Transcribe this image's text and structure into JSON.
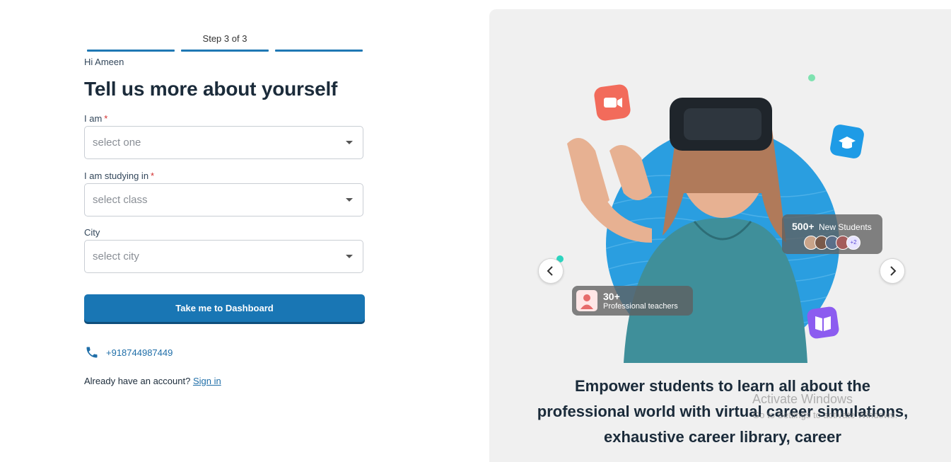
{
  "signup": {
    "step_text": "Step 3 of 3",
    "progress_steps": 3,
    "greeting": "Hi Ameen",
    "title": "Tell us more about yourself",
    "fields": [
      {
        "label": "I am",
        "required": true,
        "placeholder": "select one"
      },
      {
        "label": "I am studying in",
        "required": true,
        "placeholder": "select class"
      },
      {
        "label": "City",
        "required": false,
        "placeholder": "select city"
      }
    ],
    "submit_label": "Take me to Dashboard",
    "phone": "+918744987449",
    "account_prompt": "Already have an account?",
    "sign_in_label": "Sign in"
  },
  "hero": {
    "students_count": "500+",
    "students_label": "New Students",
    "avatar_extra": "+2",
    "teachers_count": "30+",
    "teachers_label": "Professional teachers",
    "tagline": "Empower students to learn all about the professional world with virtual career simulations, exhaustive career library, career",
    "watermark_title": "Activate Windows",
    "watermark_sub": "Go to Settings to activate Windows."
  },
  "colors": {
    "primary": "#1976b4",
    "circle": "#2a9ee0",
    "panel_bg": "#f0f0f0",
    "video_icon": "#f26b5b",
    "cap_icon": "#1e9be6",
    "book_icon": "#8c5cf0"
  }
}
